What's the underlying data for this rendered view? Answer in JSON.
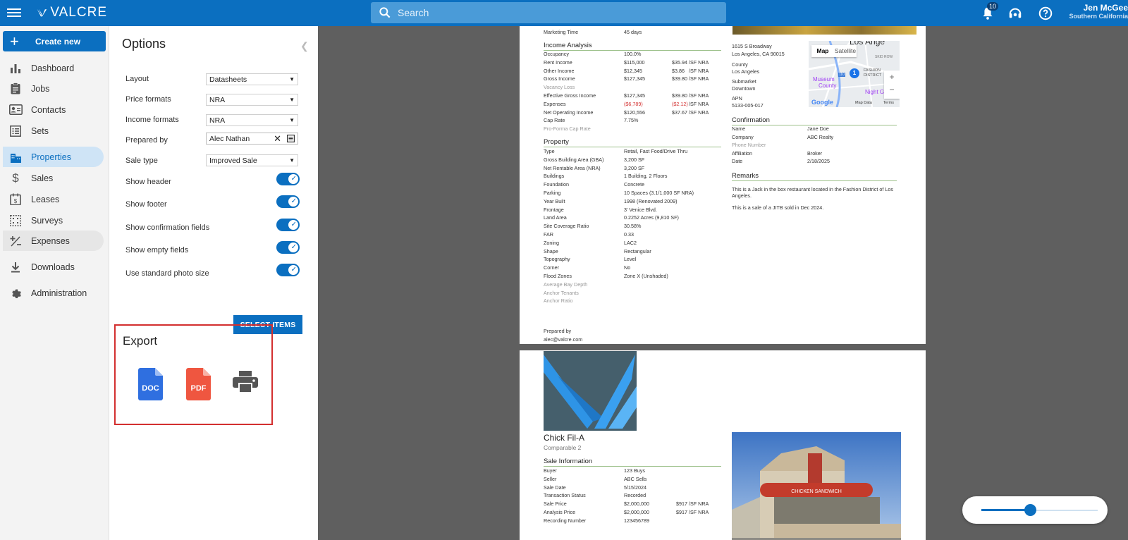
{
  "app": {
    "name": "VALCRE"
  },
  "search": {
    "placeholder": "Search"
  },
  "topbar": {
    "notification_count": "10",
    "user_name": "Jen McGee",
    "user_region": "Southern California"
  },
  "nav": {
    "create_label": "Create new",
    "items": [
      {
        "label": "Dashboard",
        "icon": "bar-chart-icon"
      },
      {
        "label": "Jobs",
        "icon": "clipboard-icon"
      },
      {
        "label": "Contacts",
        "icon": "contact-card-icon"
      },
      {
        "label": "Sets",
        "icon": "list-icon"
      },
      {
        "label": "Properties",
        "icon": "building-icon"
      },
      {
        "label": "Sales",
        "icon": "dollar-icon"
      },
      {
        "label": "Leases",
        "icon": "lease-icon"
      },
      {
        "label": "Surveys",
        "icon": "survey-grid-icon"
      },
      {
        "label": "Expenses",
        "icon": "plus-minus-icon"
      },
      {
        "label": "Downloads",
        "icon": "download-icon"
      },
      {
        "label": "Administration",
        "icon": "gear-icon"
      }
    ]
  },
  "options": {
    "title": "Options",
    "layout_label": "Layout",
    "layout_value": "Datasheets",
    "price_label": "Price formats",
    "price_value": "NRA",
    "income_label": "Income formats",
    "income_value": "NRA",
    "prepared_label": "Prepared by",
    "prepared_value": "Alec Nathan",
    "saletype_label": "Sale type",
    "saletype_value": "Improved Sale",
    "toggles": [
      {
        "label": "Show header",
        "on": true
      },
      {
        "label": "Show footer",
        "on": true
      },
      {
        "label": "Show confirmation fields",
        "on": true
      },
      {
        "label": "Show empty fields",
        "on": true
      },
      {
        "label": "Use standard photo size",
        "on": true
      }
    ],
    "select_items_label": "SELECT ITEMS"
  },
  "export": {
    "title": "Export",
    "doc_label": "DOC",
    "pdf_label": "PDF"
  },
  "report1": {
    "marketing_label": "Marketing Time",
    "marketing_value": "45 days",
    "income_title": "Income Analysis",
    "income_rows": [
      {
        "label": "Occupancy",
        "value": "100.0%",
        "unit": "",
        "per": ""
      },
      {
        "label": "Rent Income",
        "value": "$115,000",
        "unit": "$35.94",
        "per": "/SF NRA"
      },
      {
        "label": "Other Income",
        "value": "$12,345",
        "unit": "$3.86",
        "per": "/SF NRA"
      },
      {
        "label": "Gross Income",
        "value": "$127,345",
        "unit": "$39.80",
        "per": "/SF NRA"
      },
      {
        "label": "Vacancy Loss",
        "value": "",
        "unit": "",
        "per": "",
        "empty": true
      },
      {
        "label": "Effective Gross Income",
        "value": "$127,345",
        "unit": "$39.80",
        "per": "/SF NRA"
      },
      {
        "label": "Expenses",
        "value": "($6,789)",
        "unit": "($2.12)",
        "per": "/SF NRA",
        "neg": true
      },
      {
        "label": "Net Operating Income",
        "value": "$120,556",
        "unit": "$37.67",
        "per": "/SF NRA"
      },
      {
        "label": "Cap Rate",
        "value": "7.75%",
        "unit": "",
        "per": ""
      },
      {
        "label": "Pro-Forma Cap Rate",
        "value": "",
        "unit": "",
        "per": "",
        "empty": true
      }
    ],
    "property_title": "Property",
    "property_rows": [
      {
        "label": "Type",
        "value": "Retail, Fast Food/Drive Thru"
      },
      {
        "label": "Gross Building Area (GBA)",
        "value": "3,200 SF"
      },
      {
        "label": "Net Rentable Area (NRA)",
        "value": "3,200 SF"
      },
      {
        "label": "Buildings",
        "value": "1 Building, 2 Floors"
      },
      {
        "label": "Foundation",
        "value": "Concrete"
      },
      {
        "label": "Parking",
        "value": "10 Spaces (3.1/1,000 SF NRA)"
      },
      {
        "label": "Year Built",
        "value": "1998 (Renovated 2009)"
      },
      {
        "label": "Frontage",
        "value": "3' Venice Blvd."
      },
      {
        "label": "Land Area",
        "value": "0.2252 Acres (9,810 SF)"
      },
      {
        "label": "Site Coverage Ratio",
        "value": "30.58%"
      },
      {
        "label": "FAR",
        "value": "0.33"
      },
      {
        "label": "Zoning",
        "value": "LAC2"
      },
      {
        "label": "Shape",
        "value": "Rectangular"
      },
      {
        "label": "Topography",
        "value": "Level"
      },
      {
        "label": "Corner",
        "value": "No"
      },
      {
        "label": "Flood Zones",
        "value": "Zone X (Unshaded)"
      },
      {
        "label": "Average Bay Depth",
        "value": "",
        "empty": true
      },
      {
        "label": "Anchor Tenants",
        "value": "",
        "empty": true
      },
      {
        "label": "Anchor Ratio",
        "value": "",
        "empty": true
      }
    ],
    "prepared_by_label": "Prepared by",
    "prepared_by_email": "alec@valcre.com",
    "address_line1": "1615 S Broadway",
    "address_line2": "Los Angeles, CA 90015",
    "county_label": "County",
    "county_value": "Los Angeles",
    "submarket_label": "Submarket",
    "submarket_value": "Downtown",
    "apn_label": "APN",
    "apn_value": "5133-005-017",
    "map": {
      "tab_map": "Map",
      "tab_satellite": "Satellite",
      "top_text": "Los Ange",
      "skid_row": "SKID ROW",
      "fashion": "FASHION",
      "district": "DISTRICT",
      "museum": "Museum",
      "county": "County",
      "night": "Night Gal",
      "google": "Google",
      "map_data": "Map Data",
      "terms": "Terms",
      "route": "110",
      "pin": "1",
      "zoom_in": "+",
      "zoom_out": "−"
    },
    "confirmation_title": "Confirmation",
    "confirmation_rows": [
      {
        "label": "Name",
        "value": "Jane Doe"
      },
      {
        "label": "Company",
        "value": "ABC Realty"
      },
      {
        "label": "Phone Number",
        "value": "",
        "empty": true
      },
      {
        "label": "Affiliation",
        "value": "Broker"
      },
      {
        "label": "Date",
        "value": "2/18/2025"
      }
    ],
    "remarks_title": "Remarks",
    "remarks_1a": "This is a Jack in the box restaurant located in the Fashion District of Los",
    "remarks_1b": "Angeles.",
    "remarks_2": "This is a sale of a JITB sold in Dec 2024."
  },
  "report2": {
    "name": "Chick Fil-A",
    "subtitle": "Comparable 2",
    "sale_title": "Sale Information",
    "sale_rows": [
      {
        "label": "Buyer",
        "value": "123 Buys",
        "unit": "",
        "per": ""
      },
      {
        "label": "Seller",
        "value": "ABC Sells",
        "unit": "",
        "per": ""
      },
      {
        "label": "Sale Date",
        "value": "5/15/2024",
        "unit": "",
        "per": ""
      },
      {
        "label": "Transaction Status",
        "value": "Recorded",
        "unit": "",
        "per": ""
      },
      {
        "label": "Sale Price",
        "value": "$2,000,000",
        "unit": "$917",
        "per": "/SF NRA"
      },
      {
        "label": "Analysis Price",
        "value": "$2,000,000",
        "unit": "$917",
        "per": "/SF NRA"
      },
      {
        "label": "Recording Number",
        "value": "123456789",
        "unit": "",
        "per": ""
      }
    ],
    "sign_text": "CHICKEN SANDWICH"
  },
  "zoom": {
    "level": 0.42
  }
}
